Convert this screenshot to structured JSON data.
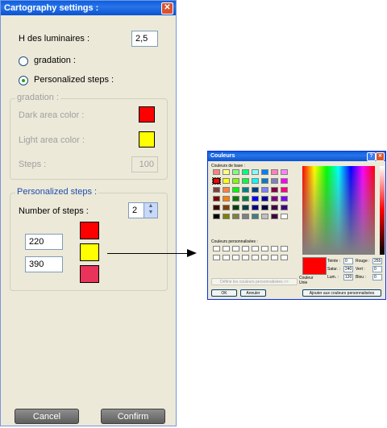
{
  "cartography": {
    "title": "Cartography settings :",
    "close_glyph": "✕",
    "h_label": "H des luminaires :",
    "h_value": "2,5",
    "radio_gradation": "gradation :",
    "radio_personalized": "Personalized steps :",
    "gradation_group": {
      "title": "gradation :",
      "dark_label": "Dark area color :",
      "light_label": "Light area color :",
      "steps_label": "Steps :",
      "steps_value": "100",
      "dark_color": "#ff0000",
      "light_color": "#ffff00"
    },
    "personalized_group": {
      "title": "Personalized steps :",
      "number_label": "Number of steps :",
      "number_value": "2",
      "step_values": [
        "220",
        "390"
      ],
      "swatch_colors": [
        "#ff0000",
        "#ffff00",
        "#e8335a"
      ]
    },
    "cancel_label": "Cancel",
    "confirm_label": "Confirm"
  },
  "couleurs": {
    "title": "Couleurs",
    "help_glyph": "?",
    "close_glyph": "✕",
    "basic_label": "Couleurs de base :",
    "custom_label": "Couleurs personnalisées :",
    "define_button": "Définir les couleurs personnalisées >>",
    "ok_button": "OK",
    "cancel_button": "Annuler",
    "add_button": "Ajouter aux couleurs personnalisées",
    "color_solid_label": "Couleur|Unie",
    "teinte_label": "Teinte :",
    "teinte_value": "0",
    "satur_label": "Satur. :",
    "satur_value": "240",
    "lum_label": "Lum. :",
    "lum_value": "120",
    "rouge_label": "Rouge :",
    "rouge_value": "255",
    "vert_label": "Vert :",
    "vert_value": "0",
    "bleu_label": "Bleu :",
    "bleu_value": "0",
    "preview_color": "#ff0000",
    "basic_colors": [
      "#ff8080",
      "#ffff80",
      "#80ff80",
      "#00ff80",
      "#80ffff",
      "#0080ff",
      "#ff80c0",
      "#ff80ff",
      "#ff0000",
      "#ffff00",
      "#80ff00",
      "#00ff40",
      "#00ffff",
      "#0080c0",
      "#8080c0",
      "#ff00ff",
      "#804040",
      "#ff8040",
      "#00ff00",
      "#008080",
      "#004080",
      "#8080ff",
      "#800040",
      "#ff0080",
      "#800000",
      "#ff8000",
      "#008000",
      "#008040",
      "#0000ff",
      "#0000a0",
      "#800080",
      "#8000ff",
      "#400000",
      "#804000",
      "#004000",
      "#004040",
      "#000080",
      "#000040",
      "#400040",
      "#400080",
      "#000000",
      "#808000",
      "#808040",
      "#808080",
      "#408080",
      "#c0c0c0",
      "#400040",
      "#ffffff"
    ]
  }
}
